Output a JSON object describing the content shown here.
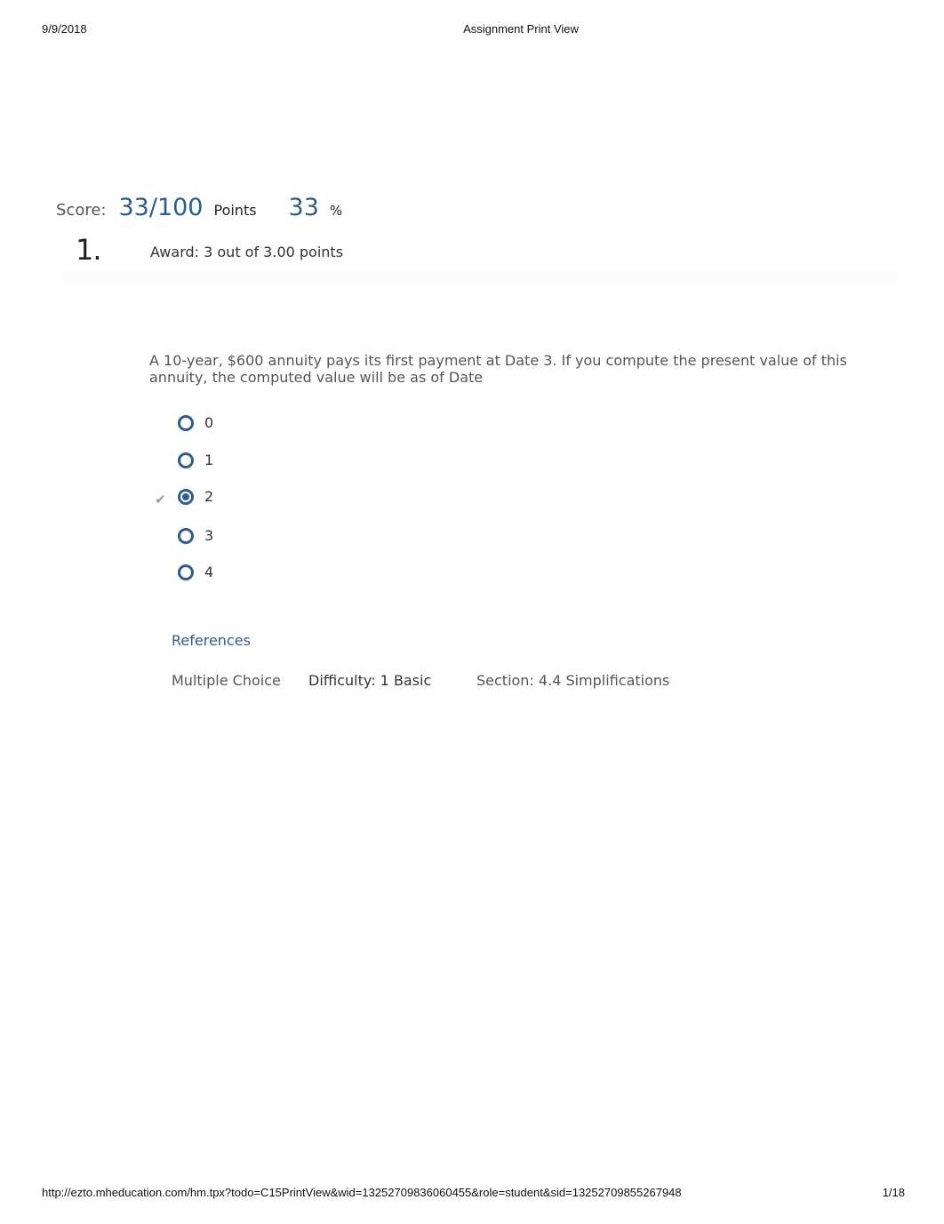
{
  "print_header": {
    "date": "9/9/2018",
    "title": "Assignment Print View"
  },
  "score": {
    "label": "Score:",
    "value": "33/100",
    "points_label": "Points",
    "percent": "33",
    "percent_sign": "%"
  },
  "question": {
    "number": "1.",
    "award": "Award: 3 out of 3.00 points",
    "text": "A 10-year, $600 annuity pays its first payment at Date 3. If you compute the present value of this annuity, the computed value will be as of Date",
    "choices": [
      {
        "label": "0",
        "selected": false
      },
      {
        "label": "1",
        "selected": false
      },
      {
        "label": "2",
        "selected": true,
        "correct": true
      },
      {
        "label": "3",
        "selected": false
      },
      {
        "label": "4",
        "selected": false
      }
    ],
    "correct_icon": "checkmark-icon",
    "references_label": "References",
    "type": "Multiple Choice",
    "difficulty": "Difficulty: 1 Basic",
    "section": "Section: 4.4 Simplifications"
  },
  "print_footer": {
    "url": "http://ezto.mheducation.com/hm.tpx?todo=C15PrintView&wid=13252709836060455&role=student&sid=13252709855267948",
    "page": "1/18"
  },
  "colors": {
    "accent": "#2d5c8e",
    "text": "#333333",
    "muted": "#555555"
  }
}
